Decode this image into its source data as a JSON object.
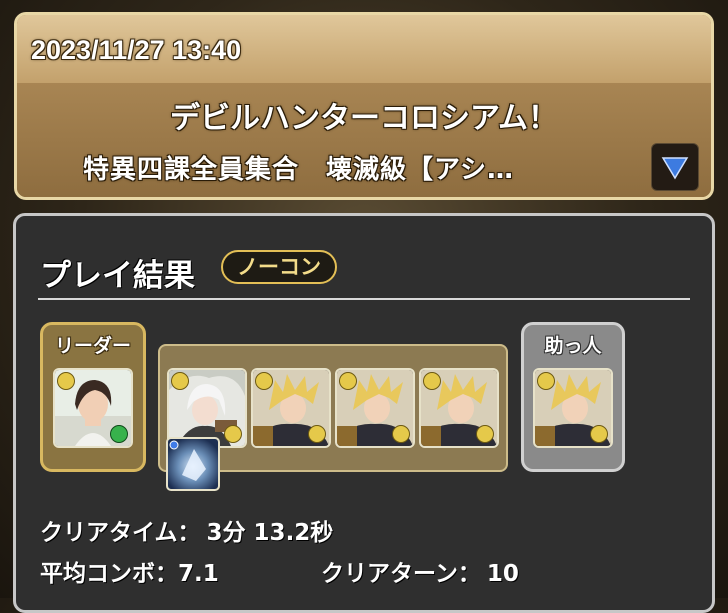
{
  "header": {
    "date": "2023/11/27 13:40",
    "dungeon_title": "デビルハンターコロシアム！",
    "dungeon_subtitle": "特異四課全員集合　壊滅級【アシ…",
    "expand_icon": "triangle-down-icon",
    "accent_color": "#3d7be0"
  },
  "result": {
    "title": "プレイ結果",
    "badge": "ノーコン",
    "leader_label": "リーダー",
    "helper_label": "助っ人",
    "clear_time_label": "クリアタイム：",
    "clear_time_value": "3分 13.2秒",
    "avg_combo_label": "平均コンボ：",
    "avg_combo_value": "7.1",
    "clear_turn_label": "クリアターン：",
    "clear_turn_value": "10"
  },
  "team": {
    "leader": {
      "icon": "dark-haired-character-portrait"
    },
    "subs": [
      {
        "icon": "white-haired-character-portrait"
      },
      {
        "icon": "blonde-swordsman-portrait"
      },
      {
        "icon": "blonde-swordsman-portrait"
      },
      {
        "icon": "blonde-swordsman-portrait"
      }
    ],
    "assist": {
      "icon": "blue-crystal-equip-icon"
    },
    "helper": {
      "icon": "blonde-swordsman-portrait"
    }
  }
}
